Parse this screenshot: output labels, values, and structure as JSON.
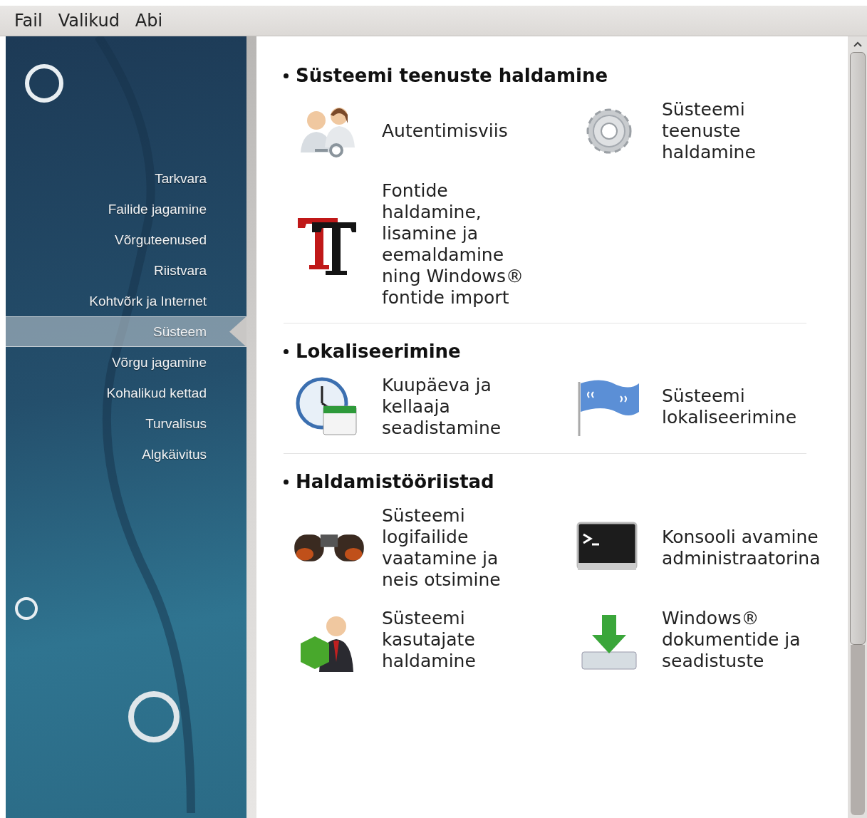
{
  "menu": [
    "Fail",
    "Valikud",
    "Abi"
  ],
  "sidebar": {
    "items": [
      {
        "label": "Tarkvara",
        "selected": false
      },
      {
        "label": "Failide jagamine",
        "selected": false
      },
      {
        "label": "Võrguteenused",
        "selected": false
      },
      {
        "label": "Riistvara",
        "selected": false
      },
      {
        "label": "Kohtvõrk ja Internet",
        "selected": false
      },
      {
        "label": "Süsteem",
        "selected": true
      },
      {
        "label": "Võrgu jagamine",
        "selected": false
      },
      {
        "label": "Kohalikud kettad",
        "selected": false
      },
      {
        "label": "Turvalisus",
        "selected": false
      },
      {
        "label": "Algkäivitus",
        "selected": false
      }
    ]
  },
  "sections": [
    {
      "title": "Süsteemi teenuste haldamine",
      "items": [
        {
          "kind": "users",
          "label": "Autentimisviis"
        },
        {
          "kind": "gear",
          "label": "Süsteemi teenuste haldamine"
        },
        {
          "kind": "font",
          "label": "Fontide haldamine, lisamine ja eemaldamine ning Windows® fontide import"
        }
      ]
    },
    {
      "title": "Lokaliseerimine",
      "items": [
        {
          "kind": "clock",
          "label": "Kuupäeva ja kellaaja seadistamine"
        },
        {
          "kind": "flag",
          "label": "Süsteemi lokaliseerimine"
        }
      ]
    },
    {
      "title": "Haldamistööriistad",
      "items": [
        {
          "kind": "binoculars",
          "label": "Süsteemi logifailide vaatamine ja neis otsimine"
        },
        {
          "kind": "terminal",
          "label": "Konsooli avamine administraatorina"
        },
        {
          "kind": "user",
          "label": "Süsteemi kasutajate haldamine"
        },
        {
          "kind": "download",
          "label": "Windows® dokumentide ja seadistuste"
        }
      ]
    }
  ]
}
